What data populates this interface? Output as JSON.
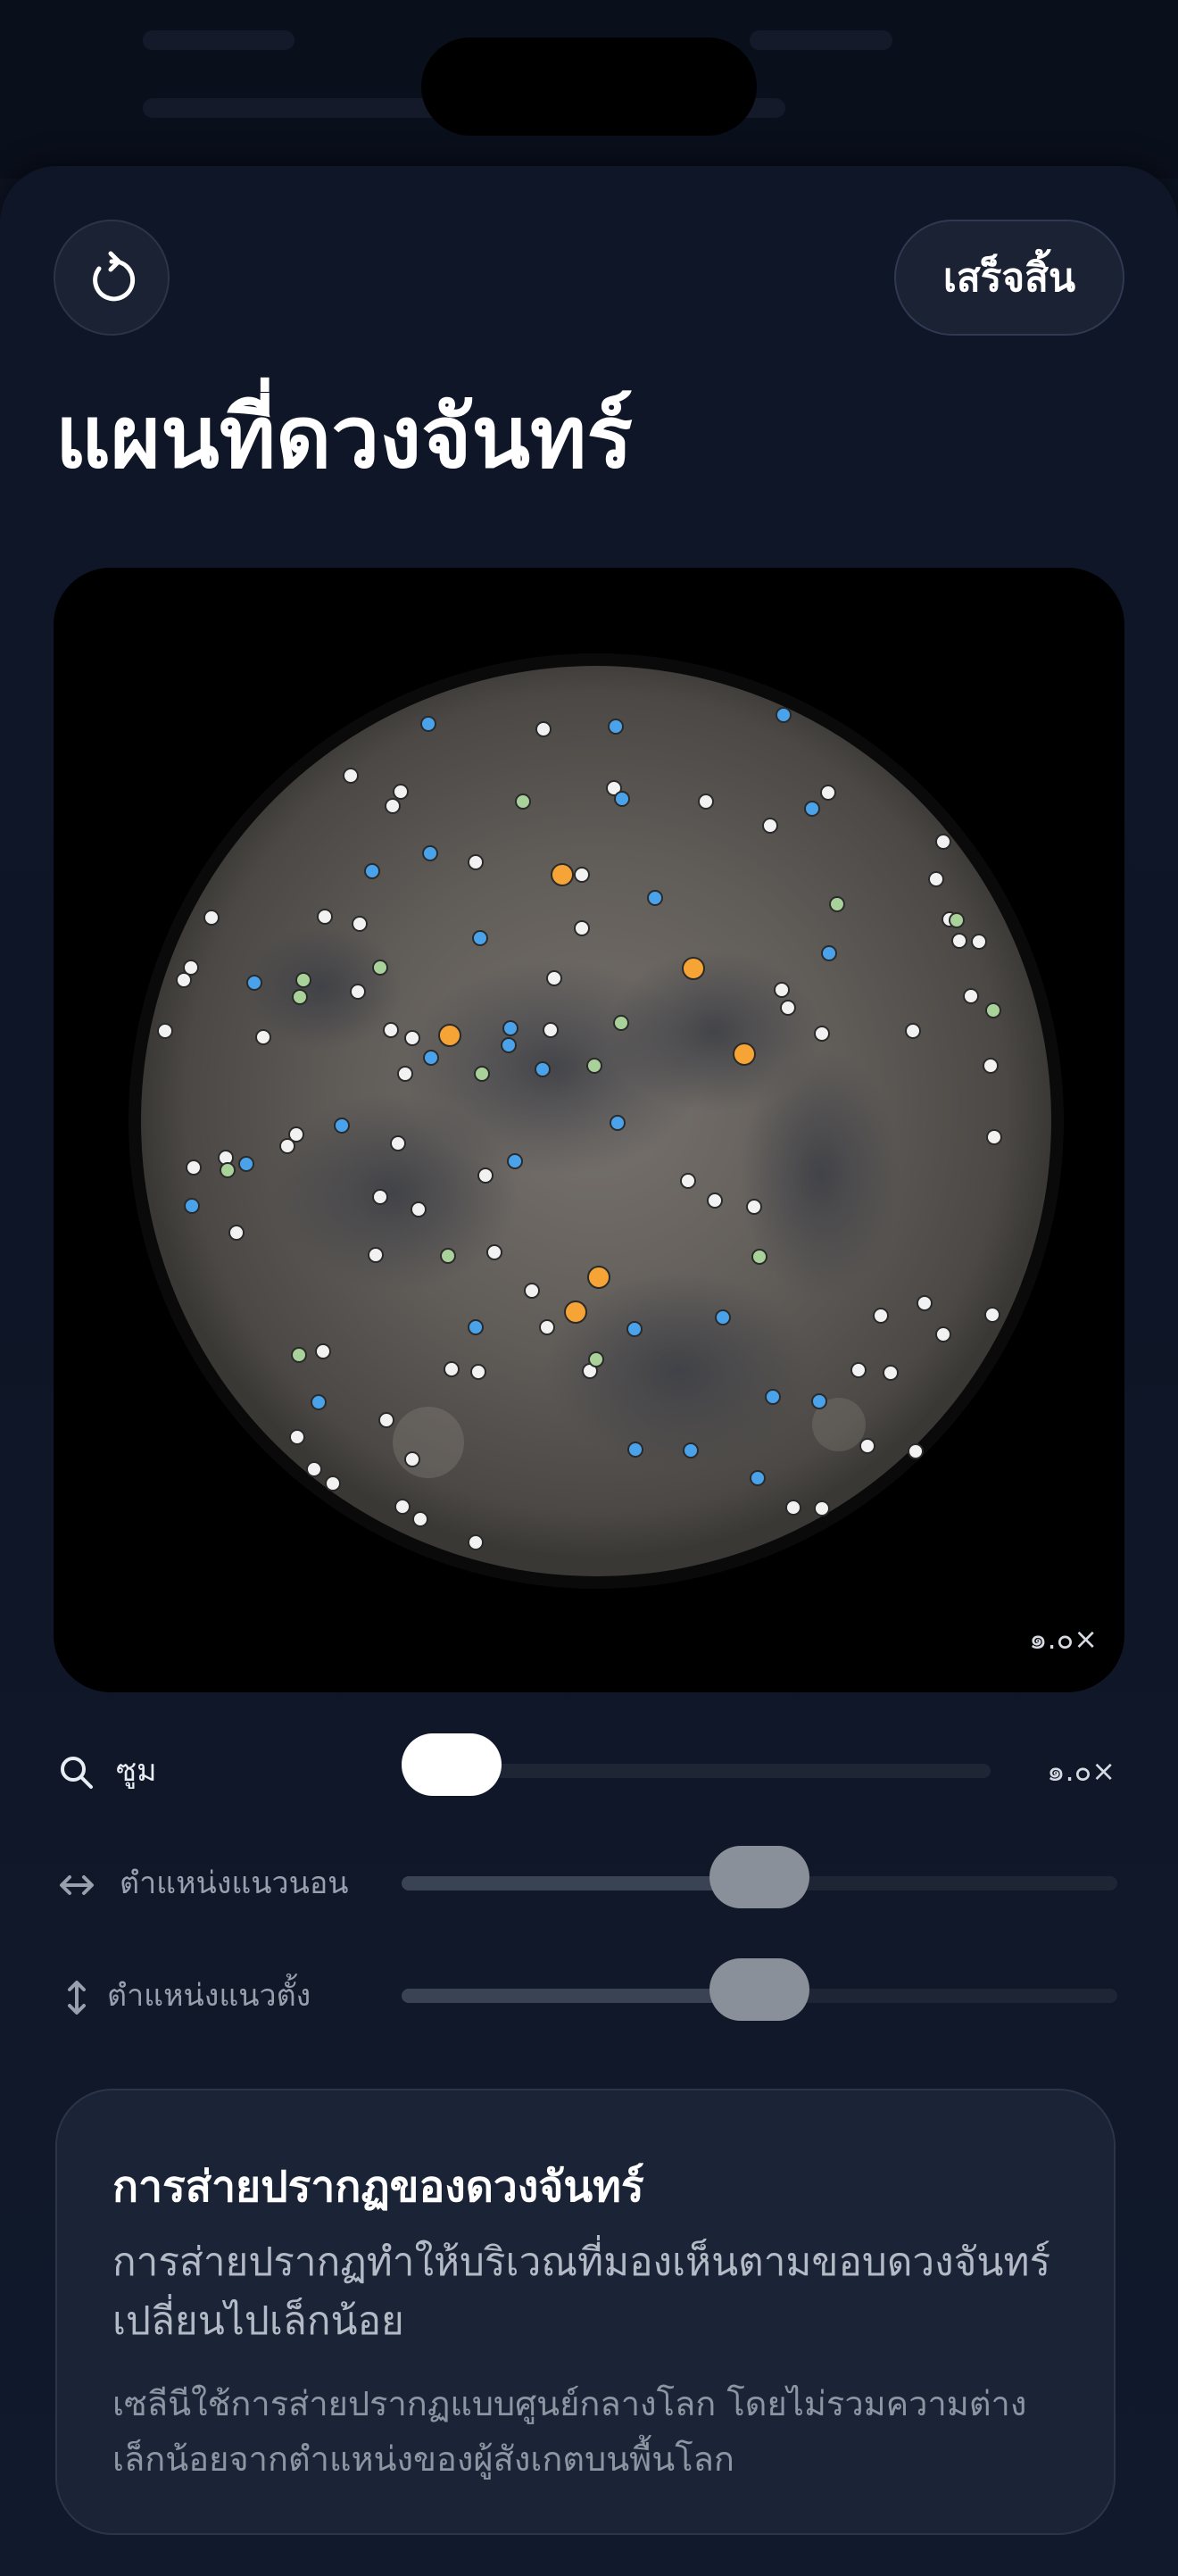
{
  "header": {
    "title": "แผนที่ดวงจันทร์",
    "reset_icon": "counterclockwise-arrow-icon",
    "done_label": "เสร็จสิ้น"
  },
  "map": {
    "zoom_readout": "๑.๐×",
    "marker_colors": {
      "white": "#f2f2f2",
      "blue": "#4aa3ea",
      "green": "#a9d29b",
      "orange": "#f7a436"
    }
  },
  "controls": {
    "zoom": {
      "icon": "magnifier-icon",
      "label": "ซูม",
      "value_text": "๑.๐×",
      "level": 0.0
    },
    "horizontal": {
      "icon": "left-right-arrow-icon",
      "label": "ตำแหน่งแนวนอน",
      "level": 0.5
    },
    "vertical": {
      "icon": "up-down-arrow-icon",
      "label": "ตำแหน่งแนวตั้ง",
      "level": 0.5
    }
  },
  "info": {
    "title": "การส่ายปรากฏของดวงจันทร์",
    "body": "การส่ายปรากฏทำให้บริเวณที่มองเห็นตามขอบดวงจันทร์เปลี่ยนไปเล็กน้อย",
    "note": "เซลีนีใช้การส่ายปรากฏแบบศูนย์กลางโลก โดยไม่รวมความต่างเล็กน้อยจากตำแหน่งของผู้สังเกตบนพื้นโลก"
  }
}
